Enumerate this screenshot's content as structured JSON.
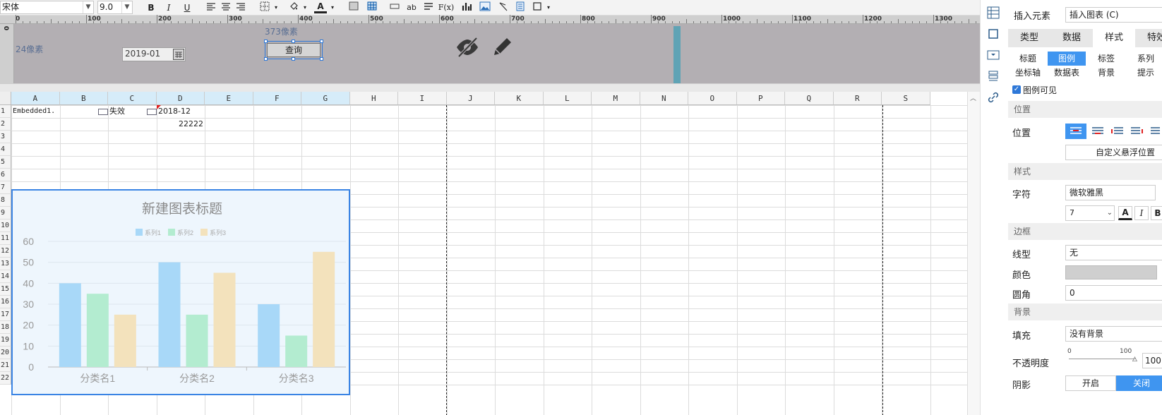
{
  "toolbar": {
    "font_name": "宋体",
    "font_size": "9.0",
    "bold": "B",
    "italic": "I",
    "underline": "U",
    "font_color_glyph": "A",
    "text_glyph": "ab",
    "formula_glyph": "F(x)"
  },
  "ruler": {
    "origin": "0",
    "labels": [
      "100",
      "200",
      "300",
      "400",
      "500",
      "600",
      "700",
      "800",
      "900",
      "1000",
      "1100",
      "1200",
      "1300"
    ],
    "vorigin": "0"
  },
  "form": {
    "width_label": "24像素",
    "height_label": "373像素",
    "date_value": "2019-01",
    "query_button": "查询"
  },
  "sheet": {
    "columns": [
      "A",
      "B",
      "C",
      "D",
      "E",
      "F",
      "G",
      "H",
      "I",
      "J",
      "K",
      "L",
      "M",
      "N",
      "O",
      "P",
      "Q",
      "R",
      "S"
    ],
    "rows": [
      "1",
      "2",
      "3",
      "4",
      "5",
      "6",
      "7",
      "8",
      "9",
      "10",
      "11",
      "12",
      "13",
      "14",
      "15",
      "16",
      "17",
      "18",
      "19",
      "20",
      "21",
      "22"
    ],
    "cells": {
      "a1": "Embedded1.",
      "c1": "失效",
      "d1": "2018-12",
      "d2": "22222"
    }
  },
  "chart_data": {
    "type": "bar",
    "title": "新建图表标题",
    "categories": [
      "分类名1",
      "分类名2",
      "分类名3"
    ],
    "series": [
      {
        "name": "系列1",
        "values": [
          40,
          50,
          30
        ],
        "color": "#a8d8f8"
      },
      {
        "name": "系列2",
        "values": [
          35,
          25,
          15
        ],
        "color": "#b3ecd0"
      },
      {
        "name": "系列3",
        "values": [
          25,
          45,
          55
        ],
        "color": "#f3e2bc"
      }
    ],
    "yticks": [
      "0",
      "10",
      "20",
      "30",
      "40",
      "50",
      "60"
    ],
    "ylim": [
      0,
      60
    ],
    "grid": true,
    "legend_position": "top"
  },
  "panel": {
    "insert_label": "插入元素",
    "insert_value": "插入图表 (C)",
    "tabs": [
      "类型",
      "数据",
      "样式",
      "特效"
    ],
    "active_tab": "样式",
    "subtabs": [
      "标题",
      "图例",
      "标签",
      "系列",
      "坐标轴",
      "数据表",
      "背景",
      "提示"
    ],
    "legend_visible": "图例可见",
    "sec_position": "位置",
    "position_label": "位置",
    "custom_float": "自定义悬浮位置",
    "sec_style": "样式",
    "char_label": "字符",
    "font_value": "微软雅黑",
    "font_size_value": "7",
    "italic": "I",
    "bold": "B",
    "color_a": "A",
    "sec_border": "边框",
    "line_type_label": "线型",
    "line_type_value": "无",
    "color_label": "颜色",
    "radius_label": "圆角",
    "radius_value": "0",
    "sec_bg": "背景",
    "fill_label": "填充",
    "fill_value": "没有背景",
    "opacity_label": "不透明度",
    "opacity_min": "0",
    "opacity_max": "100",
    "opacity_value": "100",
    "shadow_label": "阴影",
    "shadow_on": "开启",
    "shadow_off": "关闭"
  }
}
